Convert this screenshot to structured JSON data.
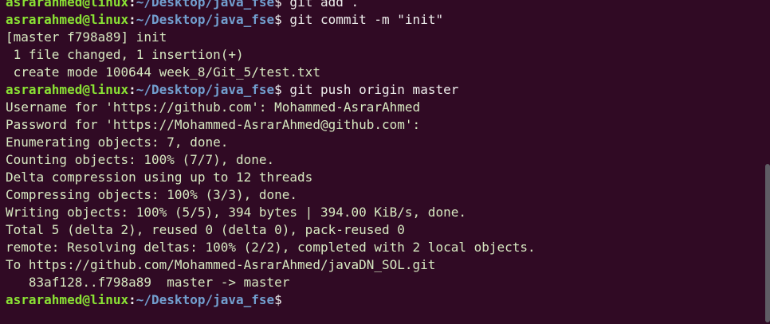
{
  "prompt": {
    "user": "asrarahmed@linux",
    "colon": ":",
    "path": "~/Desktop/java_fse",
    "dollar": "$"
  },
  "lines": [
    {
      "type": "cmd",
      "text": " git add ."
    },
    {
      "type": "cmd",
      "text": " git commit -m \"init\""
    },
    {
      "type": "out",
      "text": "[master f798a89] init"
    },
    {
      "type": "out",
      "text": " 1 file changed, 1 insertion(+)"
    },
    {
      "type": "out",
      "text": " create mode 100644 week_8/Git_5/test.txt"
    },
    {
      "type": "cmd",
      "text": " git push origin master"
    },
    {
      "type": "out",
      "text": "Username for 'https://github.com': Mohammed-AsrarAhmed"
    },
    {
      "type": "out",
      "text": "Password for 'https://Mohammed-AsrarAhmed@github.com':"
    },
    {
      "type": "out",
      "text": "Enumerating objects: 7, done."
    },
    {
      "type": "out",
      "text": "Counting objects: 100% (7/7), done."
    },
    {
      "type": "out",
      "text": "Delta compression using up to 12 threads"
    },
    {
      "type": "out",
      "text": "Compressing objects: 100% (3/3), done."
    },
    {
      "type": "out",
      "text": "Writing objects: 100% (5/5), 394 bytes | 394.00 KiB/s, done."
    },
    {
      "type": "out",
      "text": "Total 5 (delta 2), reused 0 (delta 0), pack-reused 0"
    },
    {
      "type": "out",
      "text": "remote: Resolving deltas: 100% (2/2), completed with 2 local objects."
    },
    {
      "type": "out",
      "text": "To https://github.com/Mohammed-AsrarAhmed/javaDN_SOL.git"
    },
    {
      "type": "out",
      "text": "   83af128..f798a89  master -> master"
    },
    {
      "type": "cmd",
      "text": ""
    }
  ],
  "colors": {
    "background": "#300a24",
    "user": "#8ae234",
    "path": "#729fcf",
    "output": "#d7e9c1"
  }
}
